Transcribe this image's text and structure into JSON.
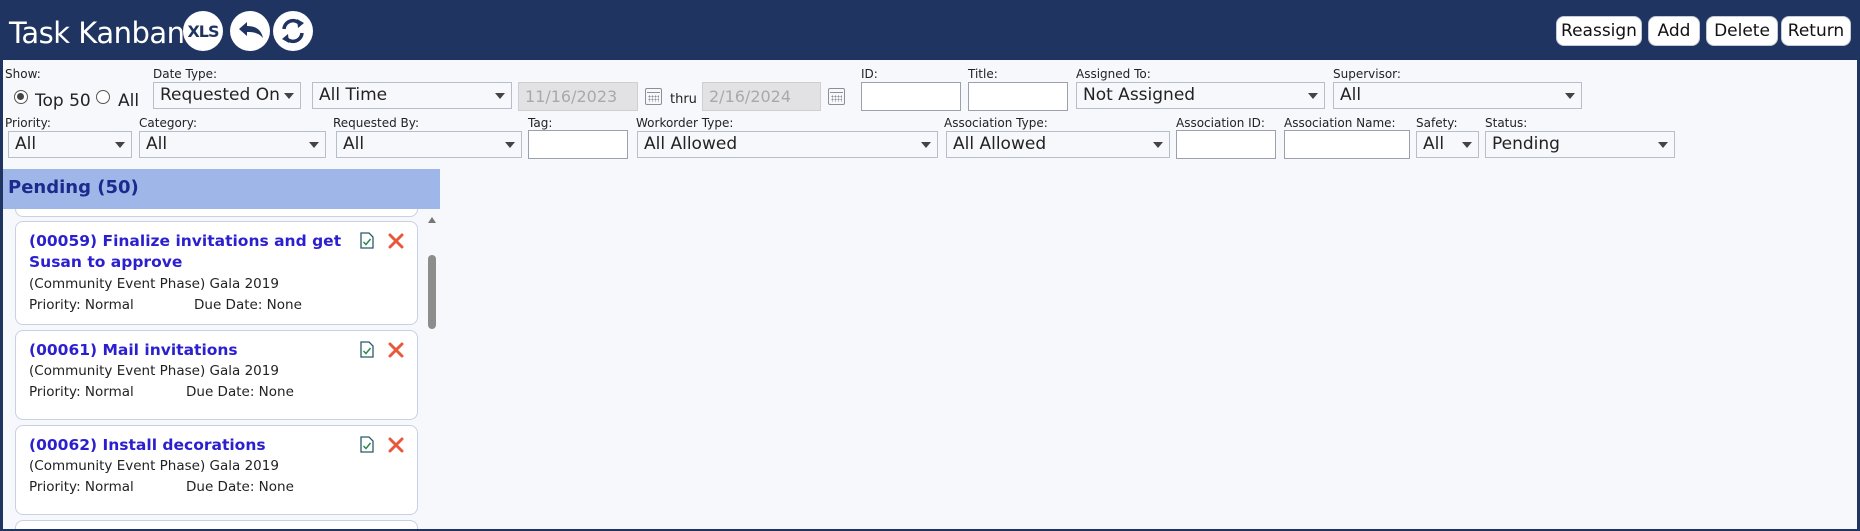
{
  "header": {
    "title": "Task Kanban",
    "xls_label": "XLS",
    "buttons": {
      "reassign": "Reassign",
      "add": "Add",
      "delete": "Delete",
      "return": "Return"
    }
  },
  "filters": {
    "show": {
      "label": "Show:",
      "option_top": "Top 50",
      "option_all": "All",
      "selected": "Top 50"
    },
    "date_type": {
      "label": "Date Type:",
      "value": "Requested On"
    },
    "date_range": {
      "value": "All Time"
    },
    "date_from": "11/16/2023",
    "date_thru_label": "thru",
    "date_to": "2/16/2024",
    "id": {
      "label": "ID:",
      "value": ""
    },
    "title": {
      "label": "Title:",
      "value": ""
    },
    "assigned_to": {
      "label": "Assigned To:",
      "value": "Not Assigned"
    },
    "supervisor": {
      "label": "Supervisor:",
      "value": "All"
    },
    "priority": {
      "label": "Priority:",
      "value": "All"
    },
    "category": {
      "label": "Category:",
      "value": "All"
    },
    "requested_by": {
      "label": "Requested By:",
      "value": "All"
    },
    "tag": {
      "label": "Tag:",
      "value": ""
    },
    "workorder_type": {
      "label": "Workorder Type:",
      "value": "All Allowed"
    },
    "association_type": {
      "label": "Association Type:",
      "value": "All Allowed"
    },
    "association_id": {
      "label": "Association ID:",
      "value": ""
    },
    "association_name": {
      "label": "Association Name:",
      "value": ""
    },
    "safety": {
      "label": "Safety:",
      "value": "All"
    },
    "status": {
      "label": "Status:",
      "value": "Pending"
    }
  },
  "kanban": {
    "column_title": "Pending (50)",
    "cards": [
      {
        "title_line1": "(00059) Finalize invitations and get",
        "title_line2": "Susan to approve",
        "subtitle": "(Community Event Phase) Gala 2019",
        "priority": "Priority: Normal",
        "due": "Due Date: None"
      },
      {
        "title_line1": "(00061) Mail invitations",
        "subtitle": "(Community Event Phase) Gala 2019",
        "priority": "Priority: Normal",
        "due": "Due Date: None"
      },
      {
        "title_line1": "(00062) Install decorations",
        "subtitle": "(Community Event Phase) Gala 2019",
        "priority": "Priority: Normal",
        "due": "Due Date: None"
      }
    ]
  },
  "colors": {
    "header_bg": "#1f3461",
    "column_header": "#9eb6e8",
    "card_title": "#2b1fd0",
    "delete_icon": "#e8593c",
    "doc_icon": "#2a7a4a"
  },
  "icons": [
    "xls-icon",
    "undo-icon",
    "refresh-icon",
    "calendar-icon",
    "document-check-icon",
    "close-icon",
    "chevron-down-icon"
  ]
}
